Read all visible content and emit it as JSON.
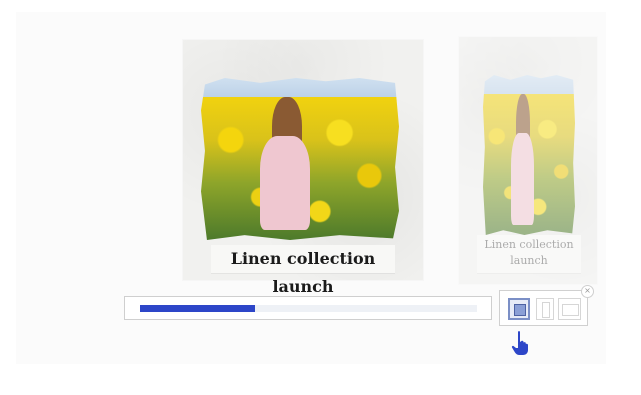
{
  "main_card": {
    "caption": "Linen collection launch"
  },
  "preview_card": {
    "caption_line1": "Linen collection",
    "caption_line2": "launch"
  },
  "progress": {
    "value_fraction": 0.34,
    "fill_color": "#2d46c8"
  },
  "format_picker": {
    "options": [
      "square",
      "portrait",
      "landscape"
    ],
    "selected": "square",
    "close_symbol": "×"
  },
  "icons": {
    "cursor": "pointer-hand-icon",
    "close": "close-icon"
  }
}
